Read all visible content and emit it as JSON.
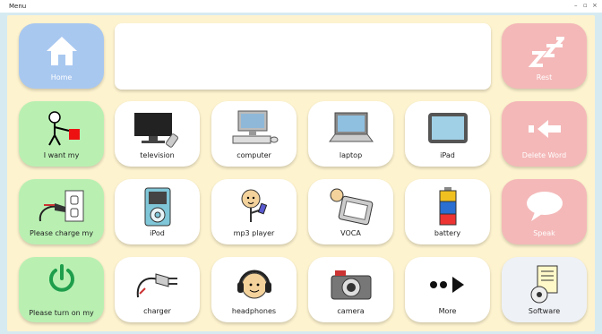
{
  "titlebar": {
    "menu": "Menu",
    "minimize": "–",
    "maximize": "▫",
    "close": "×"
  },
  "message": {
    "text": ""
  },
  "colors": {
    "green": "#b9f0b2",
    "blue": "#a9c8f0",
    "red": "#f4b8b8",
    "white": "#ffffff",
    "board": "#fdf3cf"
  },
  "tiles": {
    "home": "Home",
    "rest": "Rest",
    "i_want_my": "I want my",
    "television": "television",
    "computer": "computer",
    "laptop": "laptop",
    "ipad": "iPad",
    "delete_word": "Delete Word",
    "please_charge_my": "Please charge my",
    "ipod": "iPod",
    "mp3_player": "mp3 player",
    "voca": "VOCA",
    "battery": "battery",
    "speak": "Speak",
    "please_turn_on_my": "Please turn on my",
    "charger": "charger",
    "headphones": "headphones",
    "camera": "camera",
    "more": "More",
    "software": "Software"
  }
}
